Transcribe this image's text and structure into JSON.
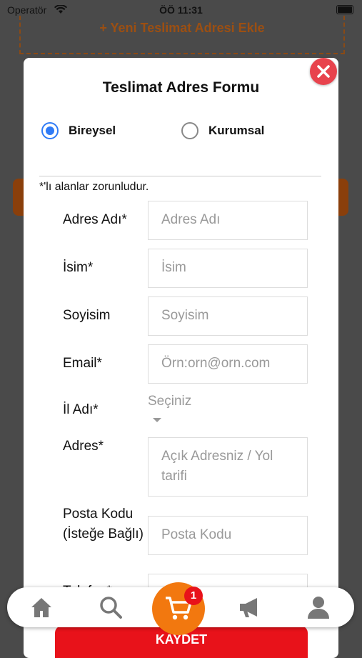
{
  "status_bar": {
    "carrier": "Operatör",
    "time": "ÖÖ 11:31"
  },
  "background": {
    "add_address": "+ Yeni Teslimat Adresi Ekle"
  },
  "modal": {
    "title": "Teslimat Adres Formu",
    "customer_types": [
      {
        "label": "Bireysel",
        "selected": true
      },
      {
        "label": "Kurumsal",
        "selected": false
      }
    ],
    "required_note": "*'lı alanlar zorunludur.",
    "fields": {
      "address_name": {
        "label": "Adres Adı*",
        "placeholder": "Adres Adı"
      },
      "first_name": {
        "label": "İsim*",
        "placeholder": "İsim"
      },
      "last_name": {
        "label": "Soyisim",
        "placeholder": "Soyisim"
      },
      "email": {
        "label": "Email*",
        "placeholder": "Örn:orn@orn.com"
      },
      "city": {
        "label": "İl Adı*",
        "selected": "Seçiniz"
      },
      "address": {
        "label": "Adres*",
        "placeholder": "Açık Adresniz / Yol tarifi"
      },
      "postal_code": {
        "label": "Posta Kodu (İsteğe Bağlı)",
        "placeholder": "Posta Kodu"
      },
      "phone": {
        "label": "Telefon*"
      }
    },
    "save_label": "KAYDET"
  },
  "tab_bar": {
    "items": [
      "home-icon",
      "search-icon",
      "cart-icon",
      "megaphone-icon",
      "profile-icon"
    ],
    "cart_count": "1"
  },
  "colors": {
    "accent": "#f2780f",
    "danger": "#e8121a",
    "radio": "#2f7bf6",
    "close": "#e8434d"
  }
}
